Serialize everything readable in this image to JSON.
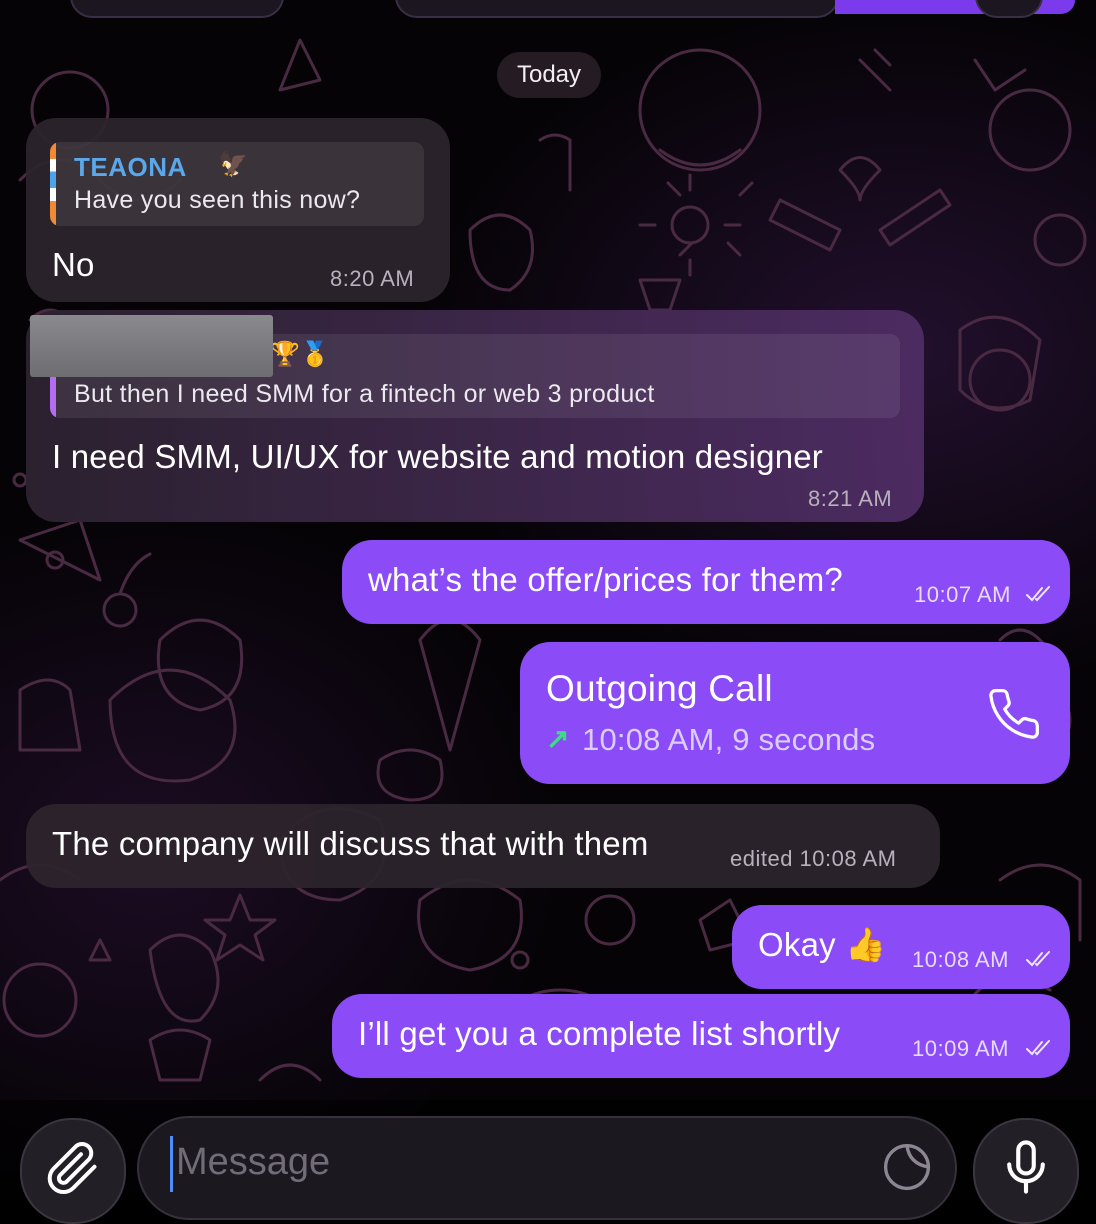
{
  "date_separator": "Today",
  "messages": {
    "m1": {
      "reply_name": "TEAONA",
      "reply_name_emoji": "🦅",
      "reply_text": "Have you seen this now?",
      "text": "No",
      "time": "8:20 AM"
    },
    "m2": {
      "reply_emojis": "🏆🥇",
      "reply_text": "But then I need SMM for a fintech or web 3 product",
      "text": "I need SMM, UI/UX for website and motion designer",
      "time": "8:21 AM"
    },
    "m3": {
      "text": "what’s the offer/prices for them?",
      "time": "10:07 AM"
    },
    "m4": {
      "title": "Outgoing Call",
      "arrow": "↗",
      "detail": "10:08 AM, 9 seconds",
      "icon": "phone-icon"
    },
    "m5": {
      "text": "The company will discuss that with them",
      "time": "edited 10:08 AM"
    },
    "m6": {
      "text": "Okay 👍",
      "time": "10:08 AM"
    },
    "m7": {
      "text": "I’ll get you a complete list shortly",
      "time": "10:09 AM"
    }
  },
  "composer": {
    "placeholder": "Message",
    "attach_icon": "paperclip-icon",
    "sticker_icon": "sticker-icon",
    "mic_icon": "microphone-icon"
  },
  "colors": {
    "outgoing_bubble": "#8b4cf7",
    "incoming_bubble": "#2c242c",
    "reply_name": "#5aa7ea",
    "call_arrow": "#3ddc84"
  }
}
